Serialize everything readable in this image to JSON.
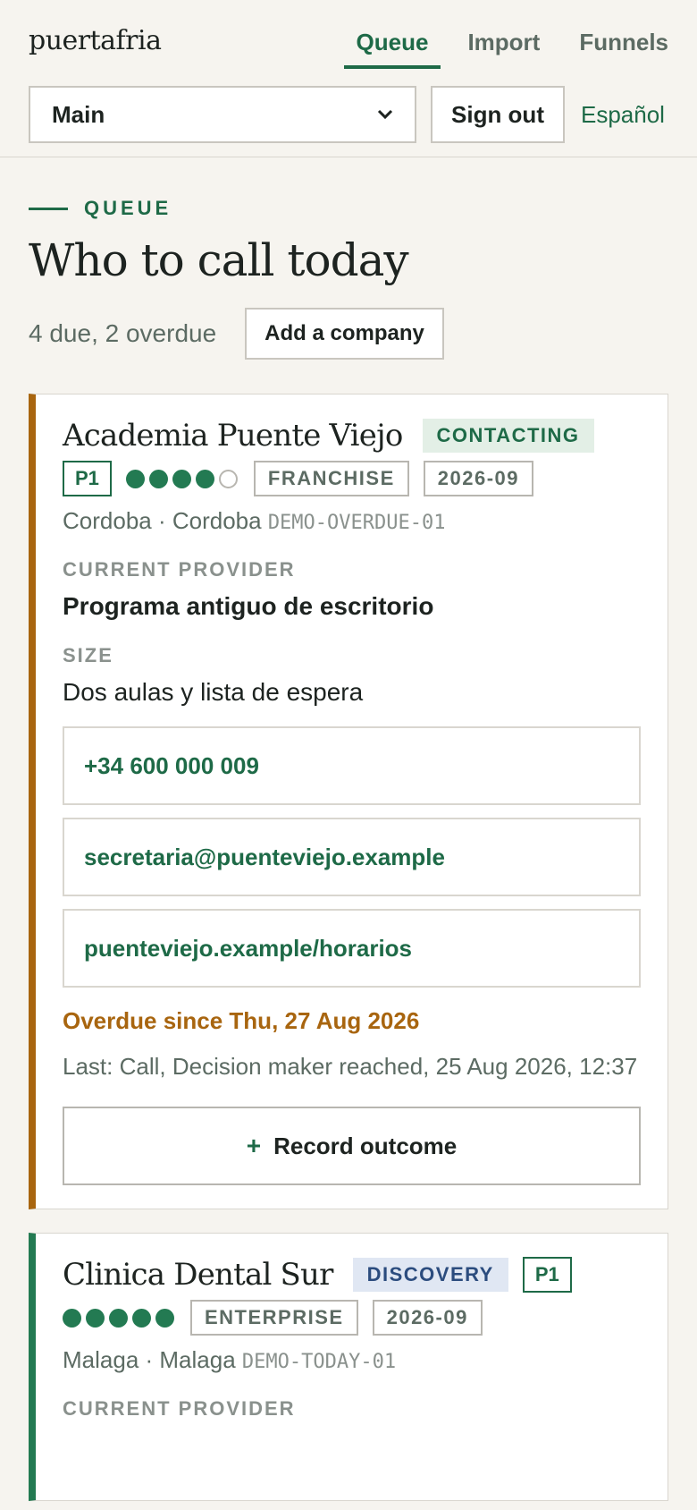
{
  "app": {
    "logo": "puertafria"
  },
  "nav": [
    {
      "label": "Queue",
      "active": true
    },
    {
      "label": "Import",
      "active": false
    },
    {
      "label": "Funnels",
      "active": false
    }
  ],
  "controls": {
    "pipeline_selected": "Main",
    "signout_label": "Sign out",
    "language_label": "Español"
  },
  "header": {
    "eyebrow": "QUEUE",
    "title": "Who to call today",
    "summary": "4 due, 2 overdue",
    "add_label": "Add a company"
  },
  "cards": [
    {
      "name": "Academia Puente Viejo",
      "status": "CONTACTING",
      "priority": "P1",
      "rating": 4,
      "rating_max": 5,
      "segment": "FRANCHISE",
      "period": "2026-09",
      "location": "Cordoba · Cordoba",
      "code": "DEMO-OVERDUE-01",
      "provider_label": "CURRENT PROVIDER",
      "provider": "Programa antiguo de escritorio",
      "size_label": "SIZE",
      "size": "Dos aulas y lista de espera",
      "phone": "+34 600 000 009",
      "email": "secretaria@puenteviejo.example",
      "website": "puenteviejo.example/horarios",
      "due_text": "Overdue since Thu, 27 Aug 2026",
      "last_text": "Last: Call, Decision maker reached, 25 Aug 2026, 12:37",
      "record_label": "Record outcome",
      "accent": "#a8650f"
    },
    {
      "name": "Clinica Dental Sur",
      "status": "DISCOVERY",
      "priority": "P1",
      "rating": 5,
      "rating_max": 5,
      "segment": "ENTERPRISE",
      "period": "2026-09",
      "location": "Malaga · Malaga",
      "code": "DEMO-TODAY-01",
      "provider_label": "CURRENT PROVIDER",
      "accent": "#237a52"
    }
  ],
  "colors": {
    "brand": "#1e6a47",
    "overdue": "#a8650f",
    "background": "#f6f4ef"
  }
}
